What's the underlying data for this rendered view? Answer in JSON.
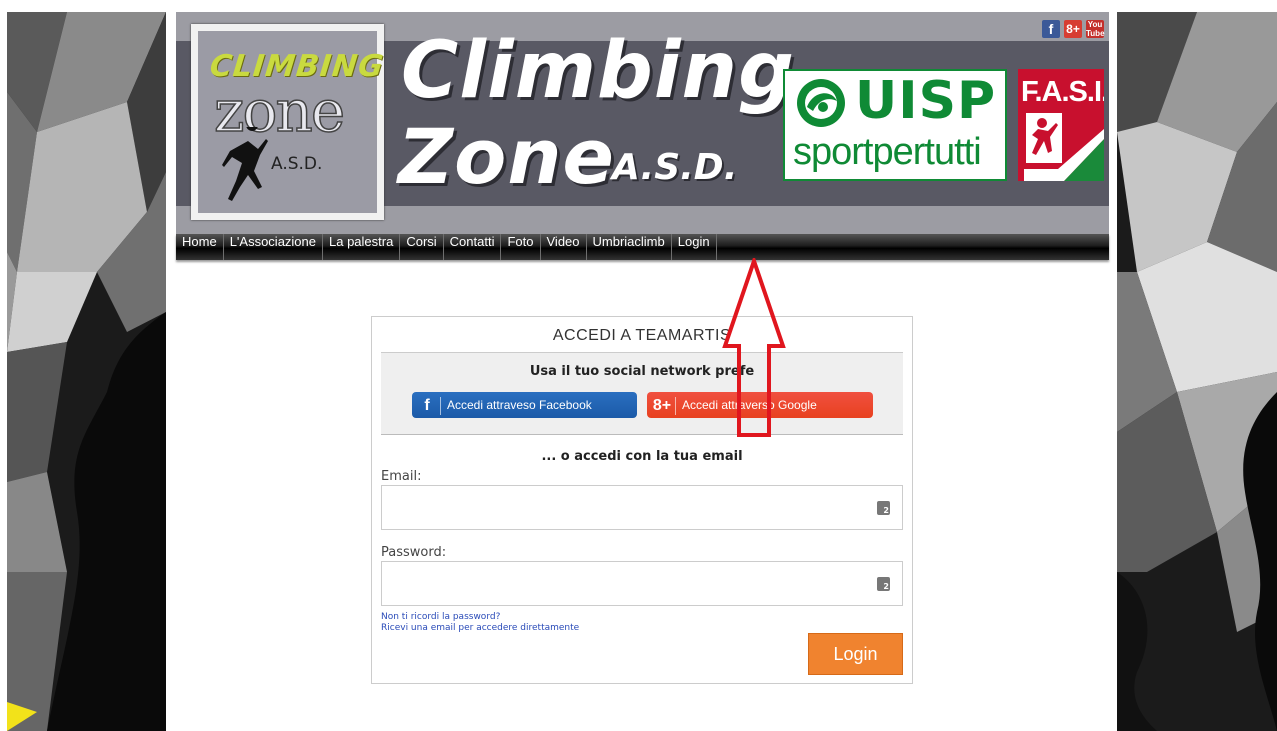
{
  "banner": {
    "logo_climbing": "CLIMBING",
    "logo_zone": "zone",
    "logo_asd": "A.S.D.",
    "title_line1": "Climbing",
    "title_line2": "Zone",
    "title_asd": "A.S.D.",
    "uisp_word": "UISP",
    "uisp_sub": "sportpertutti",
    "fasi": "F.A.S.I.",
    "social_icons": [
      "facebook-icon",
      "google-plus-icon",
      "youtube-icon"
    ],
    "social_labels": {
      "facebook": "f",
      "google": "8+",
      "youtube": "You Tube"
    }
  },
  "nav": {
    "items": [
      "Home",
      "L'Associazione",
      "La palestra",
      "Corsi",
      "Contatti",
      "Foto",
      "Video",
      "Umbriaclimb",
      "Login"
    ]
  },
  "login_box": {
    "title": "ACCEDI A TEAMARTIS",
    "social_hint": "Usa il tuo social network prefe",
    "facebook_icon": "f",
    "facebook_label": "Accedi attraveso Facebook",
    "google_icon": "8+",
    "google_label": "Accedi attraverso Google",
    "or_text": "... o accedi con la tua email",
    "email_label": "Email:",
    "email_value": "",
    "password_label": "Password:",
    "password_value": "",
    "forgot_link": "Non ti ricordi la password?",
    "email_link": "Ricevi una email per accedere direttamente",
    "login_button": "Login"
  },
  "colors": {
    "nav_bg": "#1d1d1d",
    "facebook": "#1b5aa8",
    "google": "#e8411f",
    "login_button": "#f0832f",
    "arrow": "#e0161e",
    "uisp_green": "#0f8a35",
    "fasi_red": "#c8102e"
  }
}
